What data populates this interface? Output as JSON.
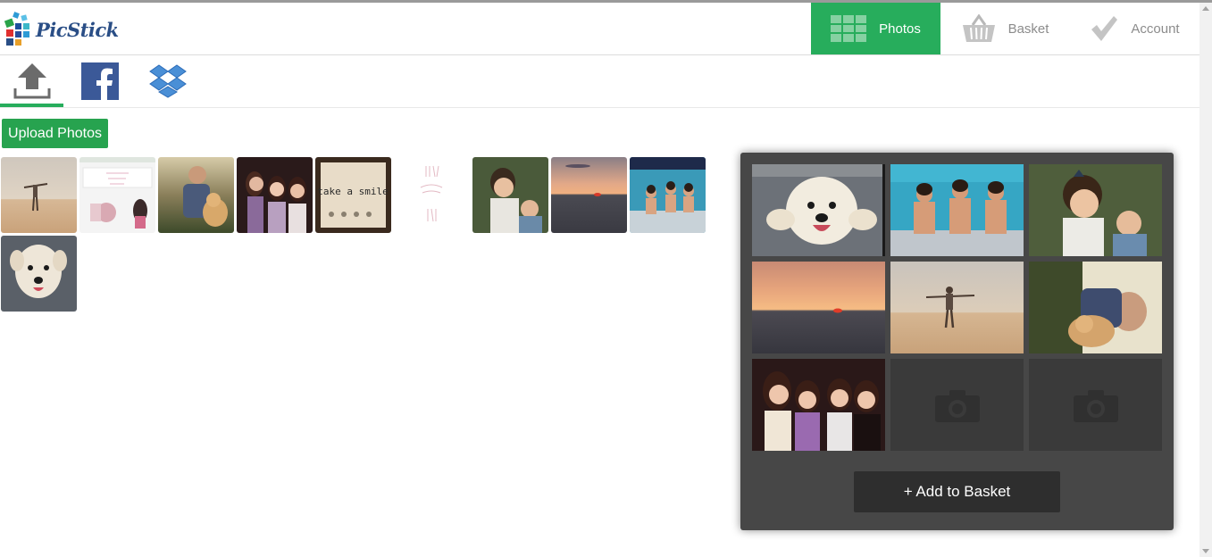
{
  "app": {
    "name": "PicStick",
    "brand_color": "#27ad5c",
    "logo_text": "PicStick"
  },
  "nav": {
    "items": [
      {
        "label": "Photos",
        "icon": "grid-icon",
        "active": true
      },
      {
        "label": "Basket",
        "icon": "basket-icon",
        "active": false
      },
      {
        "label": "Account",
        "icon": "checkmark-icon",
        "active": false
      }
    ]
  },
  "sources": {
    "tabs": [
      {
        "name": "upload",
        "icon": "upload-icon",
        "active": true
      },
      {
        "name": "facebook",
        "icon": "facebook-icon",
        "active": false
      },
      {
        "name": "dropbox",
        "icon": "dropbox-icon",
        "active": false
      }
    ]
  },
  "upload": {
    "button_label": "Upload Photos"
  },
  "gallery": {
    "photos": [
      "beach-figure-photo",
      "screenshot-collage-photo",
      "man-with-dog-photo",
      "three-girls-photo",
      "take-a-smile-photo",
      "faded-text-photo",
      "children-photo",
      "sunset-photo",
      "pool-girls-photo",
      "white-dog-photo"
    ],
    "overlay_text": {
      "take_a_smile": "take a smile"
    }
  },
  "basket_panel": {
    "slots": [
      "white-dog-photo",
      "pool-girls-photo",
      "children-photo",
      "sunset-photo",
      "beach-figure-photo",
      "man-with-dog-photo",
      "four-girls-photo",
      "empty",
      "empty"
    ],
    "add_button_label": "+ Add to Basket"
  }
}
